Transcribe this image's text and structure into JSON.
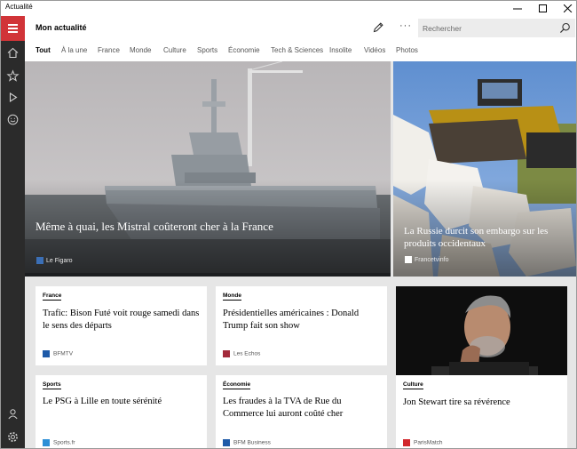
{
  "window": {
    "title": "Actualité"
  },
  "header": {
    "title": "Mon actualité",
    "search_placeholder": "Rechercher",
    "more_label": "···"
  },
  "tabs": [
    {
      "label": "Tout",
      "active": true
    },
    {
      "label": "À la une"
    },
    {
      "label": "France"
    },
    {
      "label": "Monde"
    },
    {
      "label": "Culture"
    },
    {
      "label": "Sports"
    },
    {
      "label": "Économie"
    },
    {
      "label": "Tech & Sciences"
    },
    {
      "label": "Insolite"
    },
    {
      "label": "Vidéos"
    },
    {
      "label": "Photos"
    }
  ],
  "sidebar": {
    "icons": [
      "home-icon",
      "favorites-icon",
      "video-icon",
      "smiley-icon",
      "account-icon",
      "settings-icon"
    ]
  },
  "hero": {
    "main": {
      "headline": "Même à quai, les Mistral coûteront cher à la France",
      "source": "Le Figaro"
    },
    "side": {
      "headline": "La Russie durcit son embargo sur les produits occidentaux",
      "source": "Francetvinfo"
    }
  },
  "cards": [
    {
      "category": "France",
      "title": "Trafic: Bison Futé voit rouge samedi dans le sens des départs",
      "source": "BFMTV"
    },
    {
      "category": "Monde",
      "title": "Présidentielles américaines : Donald Trump fait son show",
      "source": "Les Echos"
    },
    {
      "category": "Sports",
      "title": "Le PSG à Lille en toute sérénité",
      "source": "Sports.fr"
    },
    {
      "category": "Économie",
      "title": "Les fraudes à la TVA de Rue du Commerce lui auront coûté cher",
      "source": "BFM Business"
    },
    {
      "category": "Culture",
      "title": "Jon Stewart tire sa révérence",
      "source": "ParisMatch"
    }
  ],
  "colors": {
    "accent": "#d13438",
    "sidebar": "#2b2b2b",
    "content_bg": "#e6e6e6"
  }
}
